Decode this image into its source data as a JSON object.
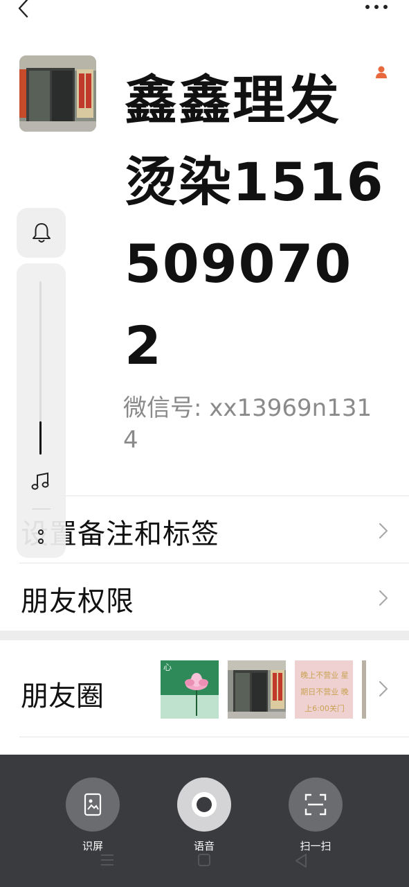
{
  "header": {
    "back_icon": "chevron-left-icon",
    "more_icon": "more-horizontal-icon"
  },
  "profile": {
    "name": "鑫鑫理发烫染15165090702",
    "wechat_id": "微信号: xx13969n1314",
    "gender_icon": "female-person-icon",
    "avatar": "shop-storefront-photo"
  },
  "rows": {
    "remark_label": "设置备注和标签",
    "permission_label": "朋友权限",
    "moments_label": "朋友圈"
  },
  "moments_thumbnails": [
    {
      "name": "lotus-image",
      "text": "心"
    },
    {
      "name": "storefront-image",
      "text": ""
    },
    {
      "name": "notice-image",
      "text": "晚上不营业 星期日不营业 晚上6:00关门"
    },
    {
      "name": "partial-image",
      "text": ""
    }
  ],
  "floating_panel": {
    "bell_icon": "bell-icon",
    "music_icon": "music-note-icon",
    "more_icon": "vertical-dots-icon",
    "volume_level": 0.19
  },
  "tools": [
    {
      "label": "识屏",
      "icon": "screen-recognition-icon"
    },
    {
      "label": "语音",
      "icon": "voice-record-icon"
    },
    {
      "label": "扫一扫",
      "icon": "scan-icon"
    }
  ],
  "colors": {
    "bottom_panel": "#3a3b3f",
    "tool_circle": "#6b6c70",
    "secondary_text": "#8a8a8a",
    "gender_icon": "#e8693e"
  }
}
